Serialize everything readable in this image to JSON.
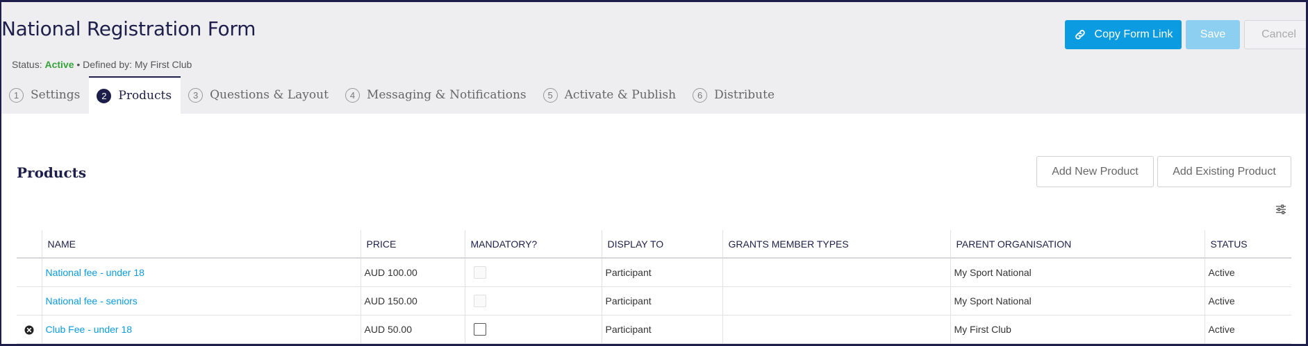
{
  "header": {
    "title": "National Registration Form",
    "status_label": "Status: ",
    "status_value": "Active",
    "defined_by": " • Defined by: My First Club",
    "copy_link_label": "Copy Form Link",
    "save_label": "Save",
    "cancel_label": "Cancel"
  },
  "tabs": [
    {
      "num": "1",
      "label": "Settings"
    },
    {
      "num": "2",
      "label": "Products"
    },
    {
      "num": "3",
      "label": "Questions & Layout"
    },
    {
      "num": "4",
      "label": "Messaging & Notifications"
    },
    {
      "num": "5",
      "label": "Activate & Publish"
    },
    {
      "num": "6",
      "label": "Distribute"
    }
  ],
  "active_tab": "Products",
  "products": {
    "title": "Products",
    "add_new_label": "Add New Product",
    "add_existing_label": "Add Existing Product",
    "columns": [
      "NAME",
      "PRICE",
      "MANDATORY?",
      "DISPLAY TO",
      "GRANTS MEMBER TYPES",
      "PARENT ORGANISATION",
      "STATUS"
    ],
    "rows": [
      {
        "name": "National fee - under 18",
        "price": "AUD 100.00",
        "mandatory": false,
        "mandatory_editable": false,
        "display_to": "Participant",
        "grants": "",
        "parent": "My Sport National",
        "status": "Active",
        "removable": false
      },
      {
        "name": "National fee - seniors",
        "price": "AUD 150.00",
        "mandatory": false,
        "mandatory_editable": false,
        "display_to": "Participant",
        "grants": "",
        "parent": "My Sport National",
        "status": "Active",
        "removable": false
      },
      {
        "name": "Club Fee - under 18",
        "price": "AUD 50.00",
        "mandatory": false,
        "mandatory_editable": true,
        "display_to": "Participant",
        "grants": "",
        "parent": "My First Club",
        "status": "Active",
        "removable": true
      }
    ]
  },
  "colors": {
    "primary": "#0a9be0",
    "navy": "#1d1f4a",
    "active_status": "#35a33a",
    "header_bg": "#eeeef1"
  },
  "icons": {
    "copy_link": "link-icon",
    "column_settings": "sliders-icon",
    "remove_row": "remove-circle-icon"
  }
}
